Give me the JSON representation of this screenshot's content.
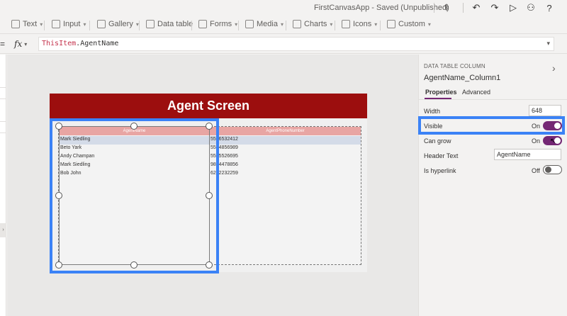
{
  "titlebar": {
    "title": "FirstCanvasApp - Saved (Unpublished)",
    "icons": [
      "stethoscope-icon",
      "undo-icon",
      "redo-icon",
      "play-icon",
      "user-icon",
      "help-icon"
    ]
  },
  "ribbon": {
    "items": [
      {
        "label": "Text",
        "icon": "text-icon"
      },
      {
        "label": "Input",
        "icon": "input-icon"
      },
      {
        "label": "Gallery",
        "icon": "gallery-icon"
      },
      {
        "label": "Data table",
        "icon": "data-table-icon"
      },
      {
        "label": "Forms",
        "icon": "forms-icon"
      },
      {
        "label": "Media",
        "icon": "media-icon"
      },
      {
        "label": "Charts",
        "icon": "charts-icon"
      },
      {
        "label": "Icons",
        "icon": "icons-icon"
      },
      {
        "label": "Custom",
        "icon": "custom-icon"
      }
    ]
  },
  "formula": {
    "fx": "fx",
    "keyword": "ThisItem",
    "rest": ".AgentName"
  },
  "screen": {
    "title": "Agent Screen"
  },
  "table": {
    "headers": [
      "AgentName",
      "AgentPhoneNumber"
    ],
    "rows": [
      [
        "Mark Siedling",
        "5556532412"
      ],
      [
        "Beto Yark",
        "5554856989"
      ],
      [
        "Andy Champan",
        "5555526695"
      ],
      [
        "Mark Siedling",
        "9854478856"
      ],
      [
        "Bob John",
        "6252232259"
      ]
    ]
  },
  "panel": {
    "type": "DATA TABLE COLUMN",
    "name": "AgentName_Column1",
    "tabs": [
      "Properties",
      "Advanced"
    ],
    "width_label": "Width",
    "width_value": "648",
    "visible_label": "Visible",
    "visible_state": "On",
    "cangrow_label": "Can grow",
    "cangrow_state": "On",
    "header_label": "Header Text",
    "header_value": "AgentName",
    "hyperlink_label": "Is hyperlink",
    "hyperlink_state": "Off"
  },
  "colors": {
    "header_red": "#9c0e0e",
    "accent_purple": "#742774",
    "highlight_blue": "#3b82f6"
  }
}
